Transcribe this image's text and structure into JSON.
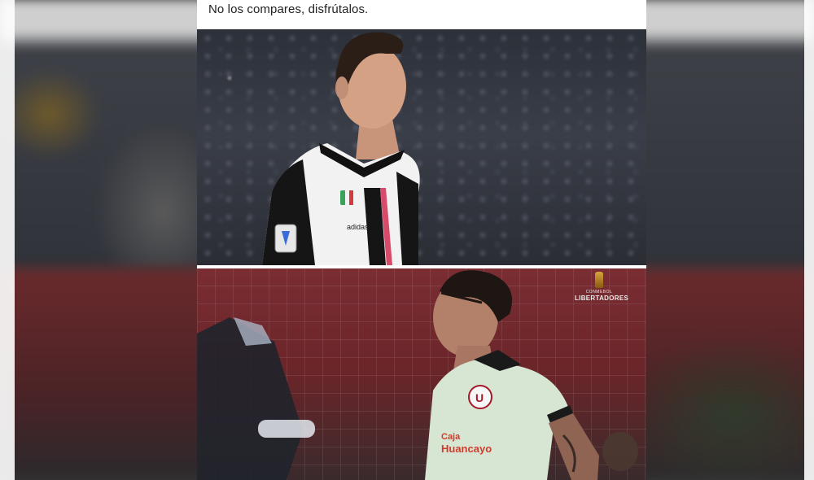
{
  "caption": "No los compares, disfrútalos.",
  "top_photo": {
    "jersey_brand": "adidas"
  },
  "bottom_photo": {
    "broadcast_bug": {
      "line1": "CONMEBOL",
      "line2": "LIBERTADORES"
    },
    "jersey_sponsor_line1": "Caja",
    "jersey_sponsor_line2": "Huancayo"
  }
}
